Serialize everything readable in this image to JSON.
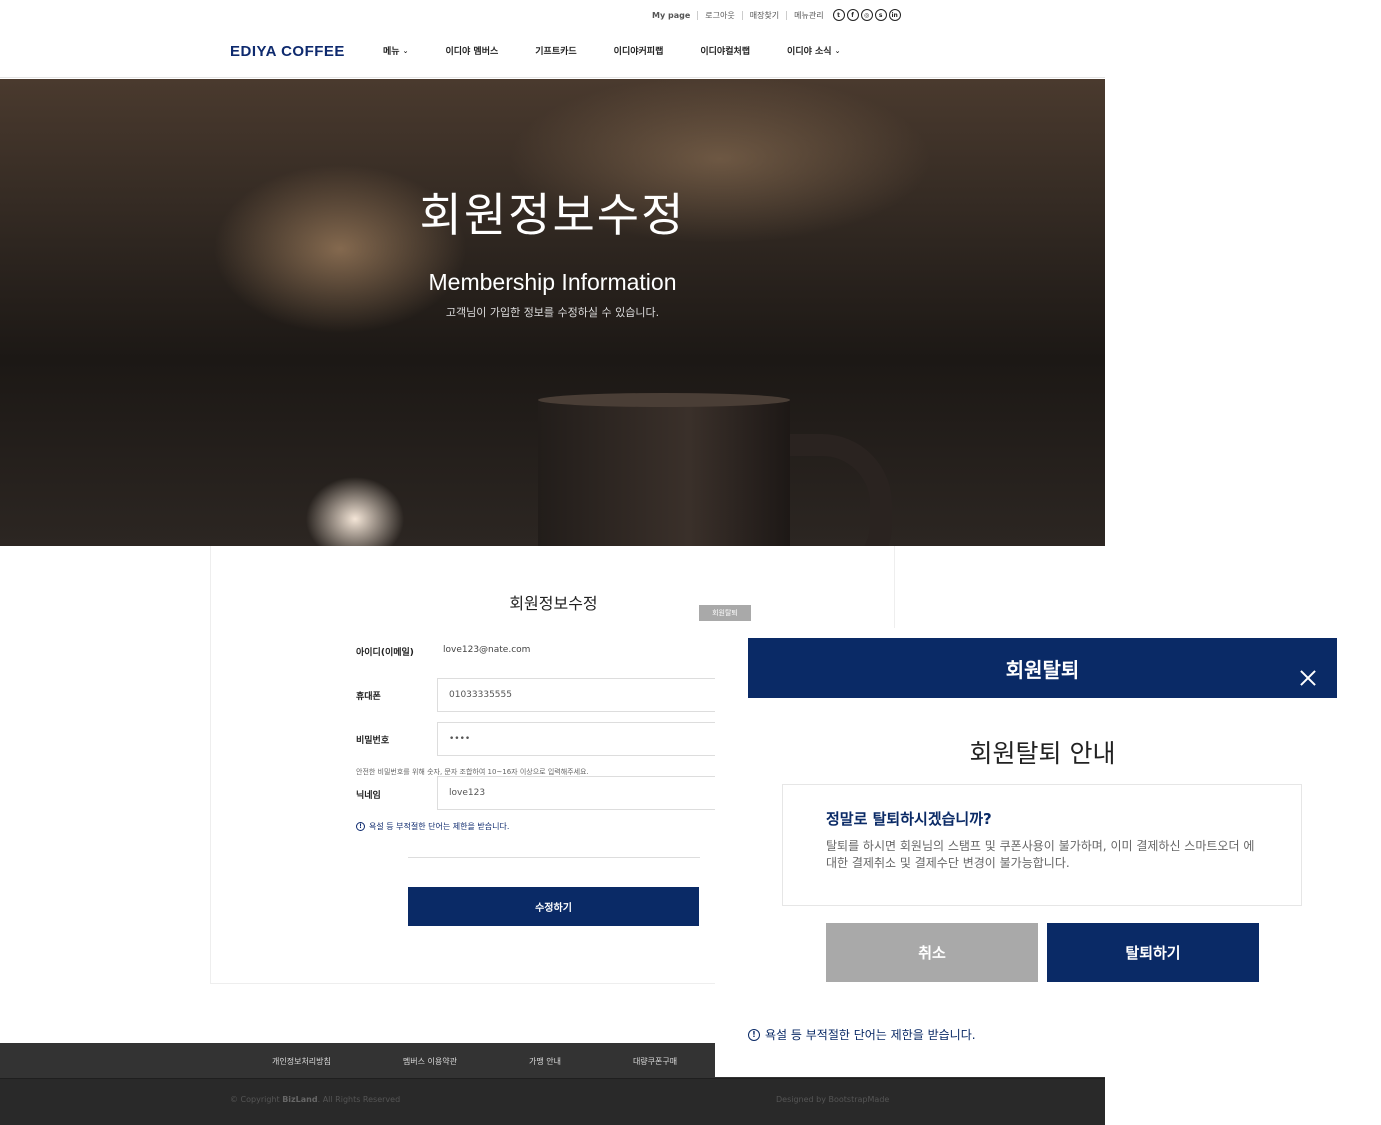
{
  "topbar": {
    "links": [
      "My page",
      "로그아웃",
      "매장찾기",
      "메뉴관리"
    ],
    "social_icons": [
      "twitter-icon",
      "facebook-icon",
      "instagram-icon",
      "skype-icon",
      "linkedin-icon"
    ]
  },
  "nav": {
    "logo": "EDIYA COFFEE",
    "items": [
      "메뉴",
      "이디야 멤버스",
      "기프트카드",
      "이디야커피랩",
      "이디야컬처랩",
      "이디야 소식"
    ]
  },
  "hero": {
    "title": "회원정보수정",
    "subtitle": "Membership Information",
    "description": "고객님이 가입한 정보를 수정하실 수 있습니다."
  },
  "form": {
    "title": "회원정보수정",
    "withdraw_tag": "회원탈퇴",
    "id_label": "아이디(이메일)",
    "id_value": "love123@nate.com",
    "phone_label": "휴대폰",
    "phone_value": "01033335555",
    "password_label": "비밀번호",
    "password_value": "••••",
    "password_hint": "안전한 비밀번호를 위해 숫자, 문자 조합하여 10~16자 이상으로 입력해주세요.",
    "nickname_label": "닉네임",
    "nickname_value": "love123",
    "nickname_note": "욕설 등 부적절한 단어는 제한을 받습니다.",
    "submit_label": "수정하기"
  },
  "footer": {
    "links": [
      "개인정보처리방침",
      "멤버스 이용약관",
      "가맹 안내",
      "대량쿠폰구매"
    ],
    "copyright_prefix": "© Copyright",
    "copyright_brand": "BizLand",
    "copyright_suffix": ". All Rights Reserved",
    "designed_by": "Designed by BootstrapMade"
  },
  "modal": {
    "title": "회원탈퇴",
    "heading": "회원탈퇴 안내",
    "question": "정말로 탈퇴하시겠습니까?",
    "message": "탈퇴를 하시면 회원님의 스탬프 및 쿠폰사용이 불가하며, 이미 결제하신 스마트오더 에 대한 결제취소 및 결제수단 변경이 불가능합니다.",
    "cancel_label": "취소",
    "confirm_label": "탈퇴하기",
    "note": "욕설 등 부적절한 단어는 제한을 받습니다."
  },
  "colors": {
    "brand": "#0a2a66",
    "gray_button": "#a9a9a9",
    "footer": "#333333"
  }
}
